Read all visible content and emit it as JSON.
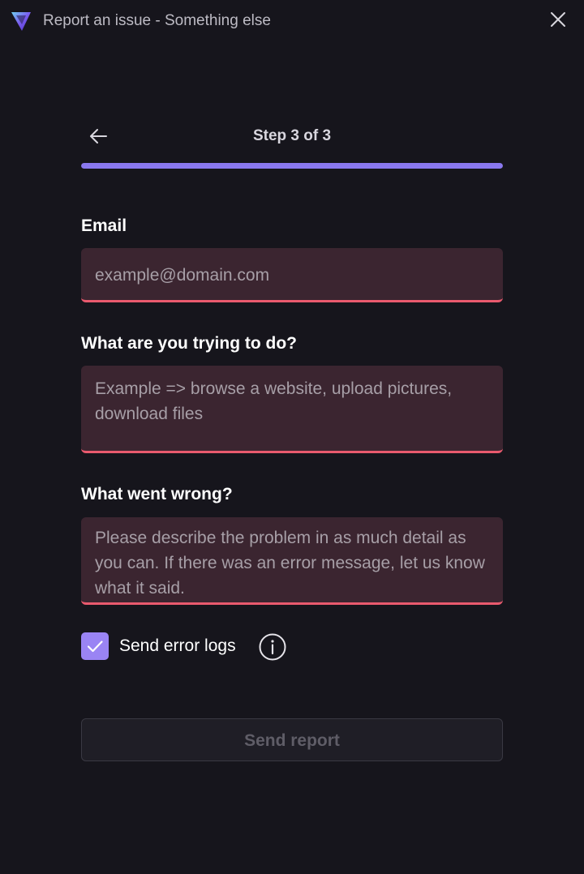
{
  "window": {
    "title": "Report an issue - Something else",
    "logo_icon": "vpn-logo-icon",
    "close_icon": "close-icon"
  },
  "wizard": {
    "back_icon": "arrow-left-icon",
    "step_label": "Step 3 of 3",
    "progress_fraction": 1.0,
    "accent_color": "#8a78ef"
  },
  "form": {
    "email": {
      "label": "Email",
      "value": "",
      "placeholder": "example@domain.com"
    },
    "intent": {
      "label": "What are you trying to do?",
      "value": "",
      "placeholder": "Example => browse a website, upload pictures, download files"
    },
    "problem": {
      "label": "What went wrong?",
      "value": "",
      "placeholder": "Please describe the problem in as much detail as you can. If there was an error message, let us know what it said."
    },
    "error_color": "#ea5a6e",
    "send_logs": {
      "label": "Send error logs",
      "checked": true,
      "info_icon": "info-icon"
    },
    "submit_label": "Send report",
    "submit_enabled": false
  }
}
